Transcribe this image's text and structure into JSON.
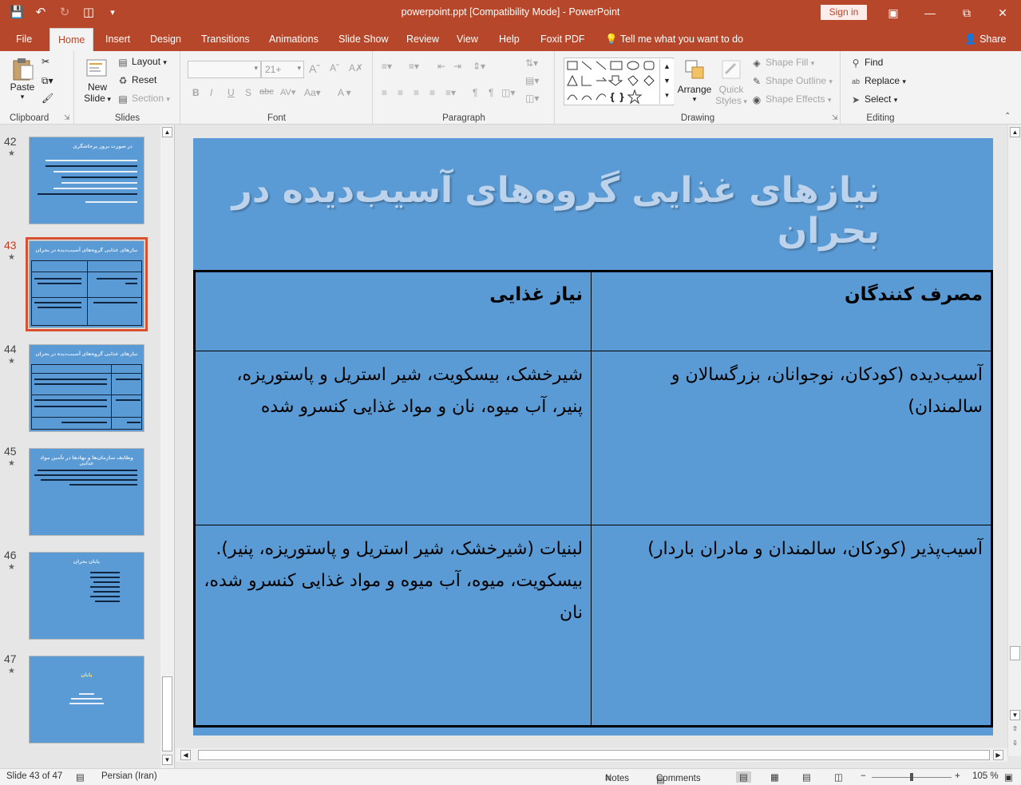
{
  "window": {
    "title": "powerpoint.ppt [Compatibility Mode]  -  PowerPoint",
    "sign_in": "Sign in"
  },
  "tabs": [
    "File",
    "Home",
    "Insert",
    "Design",
    "Transitions",
    "Animations",
    "Slide Show",
    "Review",
    "View",
    "Help",
    "Foxit PDF"
  ],
  "tell_me": "Tell me what you want to do",
  "share": "Share",
  "ribbon": {
    "clipboard": {
      "label": "Clipboard",
      "paste": "Paste"
    },
    "slides": {
      "label": "Slides",
      "new_slide_line1": "New",
      "new_slide_line2": "Slide",
      "layout": "Layout",
      "reset": "Reset",
      "section": "Section"
    },
    "font": {
      "label": "Font",
      "size": "21+"
    },
    "paragraph": {
      "label": "Paragraph"
    },
    "drawing": {
      "label": "Drawing",
      "arrange": "Arrange",
      "quick_styles_1": "Quick",
      "quick_styles_2": "Styles",
      "shape_fill": "Shape Fill",
      "shape_outline": "Shape Outline",
      "shape_effects": "Shape Effects"
    },
    "editing": {
      "label": "Editing",
      "find": "Find",
      "replace": "Replace",
      "select": "Select"
    }
  },
  "thumbnails": [
    {
      "num": "42",
      "title": "در صورت بروز پرخاشگری"
    },
    {
      "num": "43",
      "title": "نیازهای غذایی گروه‌های آسیب‌دیده در بحران"
    },
    {
      "num": "44",
      "title": "نیازهای غذایی گروه‌های آسیب‌دیده در بحران"
    },
    {
      "num": "45",
      "title": "وظایف سازمان‌ها و نهادها در تأمین مواد غذایی"
    },
    {
      "num": "46",
      "title": "پایان بحران"
    },
    {
      "num": "47",
      "title": "پایان"
    }
  ],
  "slide": {
    "title": "نیازهای غذایی گروه‌های آسیب‌دیده در بحران",
    "table": {
      "headers": [
        "مصرف کنندگان",
        "نیاز غذایی"
      ],
      "rows": [
        [
          "آسیب‌دیده (کودکان، نوجوانان، بزرگسالان و سالمندان)",
          "شیرخشک، بیسکویت، شیر استریل و پاستوریزه، پنیر، آب میوه، نان و مواد غذایی کنسرو شده"
        ],
        [
          "آسیب‌پذیر (کودکان، سالمندان و مادران باردار)",
          "لبنیات (شیرخشک، شیر استریل و پاستوریزه، پنیر). بیسکویت، میوه، آب میوه و مواد غذایی کنسرو شده، نان"
        ]
      ]
    }
  },
  "status": {
    "slide_info": "Slide 43 of 47",
    "language": "Persian (Iran)",
    "notes": "Notes",
    "comments": "Comments",
    "zoom": "105 %"
  }
}
